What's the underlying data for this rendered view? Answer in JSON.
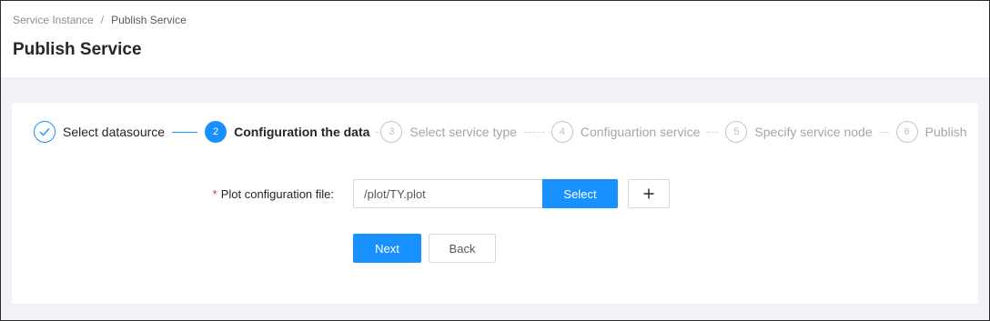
{
  "breadcrumb": {
    "items": [
      "Service Instance",
      "Publish Service"
    ],
    "separator": "/"
  },
  "page": {
    "title": "Publish Service"
  },
  "steps": [
    {
      "number": "1",
      "label": "Select datasource",
      "status": "done"
    },
    {
      "number": "2",
      "label": "Configuration the data",
      "status": "active"
    },
    {
      "number": "3",
      "label": "Select service type",
      "status": "wait"
    },
    {
      "number": "4",
      "label": "Configuartion service",
      "status": "wait"
    },
    {
      "number": "5",
      "label": "Specify service node",
      "status": "wait"
    },
    {
      "number": "6",
      "label": "Publish",
      "status": "wait"
    }
  ],
  "form": {
    "plot_config": {
      "required_mark": "*",
      "label": "Plot configuration file:",
      "value": "/plot/TY.plot",
      "select_label": "Select",
      "add_icon": "plus-icon"
    }
  },
  "actions": {
    "next_label": "Next",
    "back_label": "Back"
  },
  "colors": {
    "primary": "#1890ff",
    "required": "#f5222d",
    "page_bg": "#f0f2f5"
  }
}
